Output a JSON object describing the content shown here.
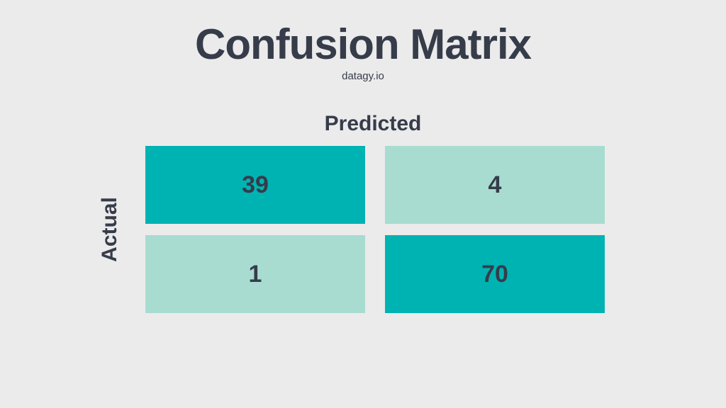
{
  "title": "Confusion Matrix",
  "subtitle": "datagy.io",
  "x_axis_label": "Predicted",
  "y_axis_label": "Actual",
  "cells": {
    "r0c0": "39",
    "r0c1": "4",
    "r1c0": "1",
    "r1c1": "70"
  },
  "colors": {
    "dark_teal": "#00b3b3",
    "light_teal": "#a8dcd1",
    "text": "#363c4a",
    "bg": "#ebebeb"
  },
  "chart_data": {
    "type": "heatmap",
    "title": "Confusion Matrix",
    "xlabel": "Predicted",
    "ylabel": "Actual",
    "categories_x": [
      "col0",
      "col1"
    ],
    "categories_y": [
      "row0",
      "row1"
    ],
    "values": [
      [
        39,
        4
      ],
      [
        1,
        70
      ]
    ]
  }
}
